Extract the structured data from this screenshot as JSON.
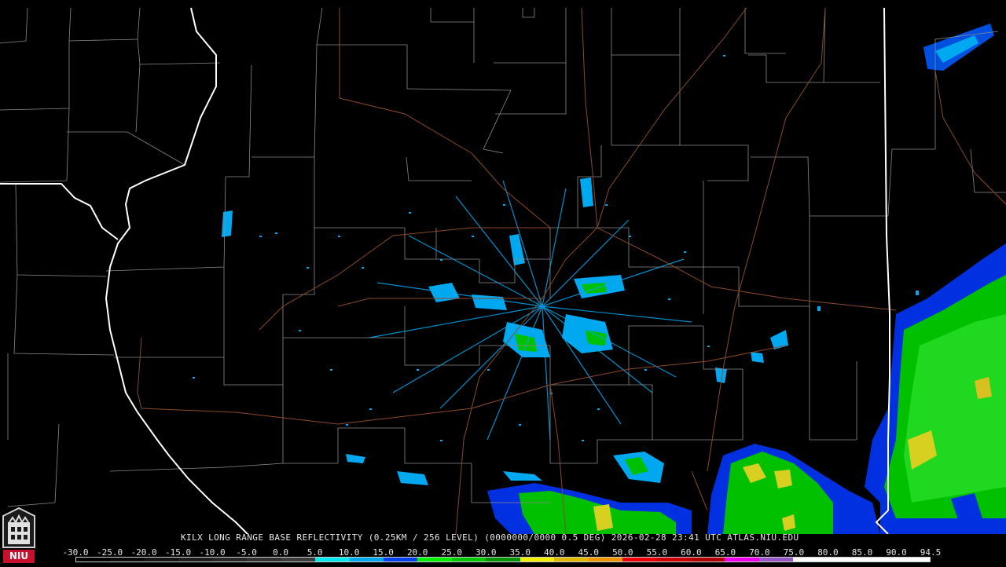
{
  "caption": "KILX LONG RANGE BASE REFLECTIVITY (0.25KM / 256 LEVEL) (0000000/0000 0.5 DEG) 2026-02-28 23:41 UTC  ATLAS.NIU.EDU",
  "logo": {
    "text": "NIU"
  },
  "scale": {
    "labels": [
      "-30.0",
      "-25.0",
      "-20.0",
      "-15.0",
      "-10.0",
      "-5.0",
      "0.0",
      "5.0",
      "10.0",
      "15.0",
      "20.0",
      "25.0",
      "30.0",
      "35.0",
      "40.0",
      "45.0",
      "50.0",
      "55.0",
      "60.0",
      "65.0",
      "70.0",
      "75.0",
      "80.0",
      "85.0",
      "90.0",
      "94.5"
    ],
    "colors": [
      "#000000",
      "#0a0a0a",
      "#141414",
      "#1e1e1e",
      "#282828",
      "#323232",
      "#3c3c3c",
      "#00e8f0",
      "#00a8f0",
      "#0040f0",
      "#00f000",
      "#00c800",
      "#009600",
      "#f0f000",
      "#e0b800",
      "#f09600",
      "#f00000",
      "#d00000",
      "#b40000",
      "#f000f0",
      "#9858c8",
      "#ffffff",
      "#ffffff",
      "#ffffff",
      "#ffffff"
    ]
  },
  "colors": {
    "background": "#000000",
    "county_lines": "#8a8a8a",
    "state_lines": "#ffffff",
    "highways": "#8b4a2b"
  }
}
